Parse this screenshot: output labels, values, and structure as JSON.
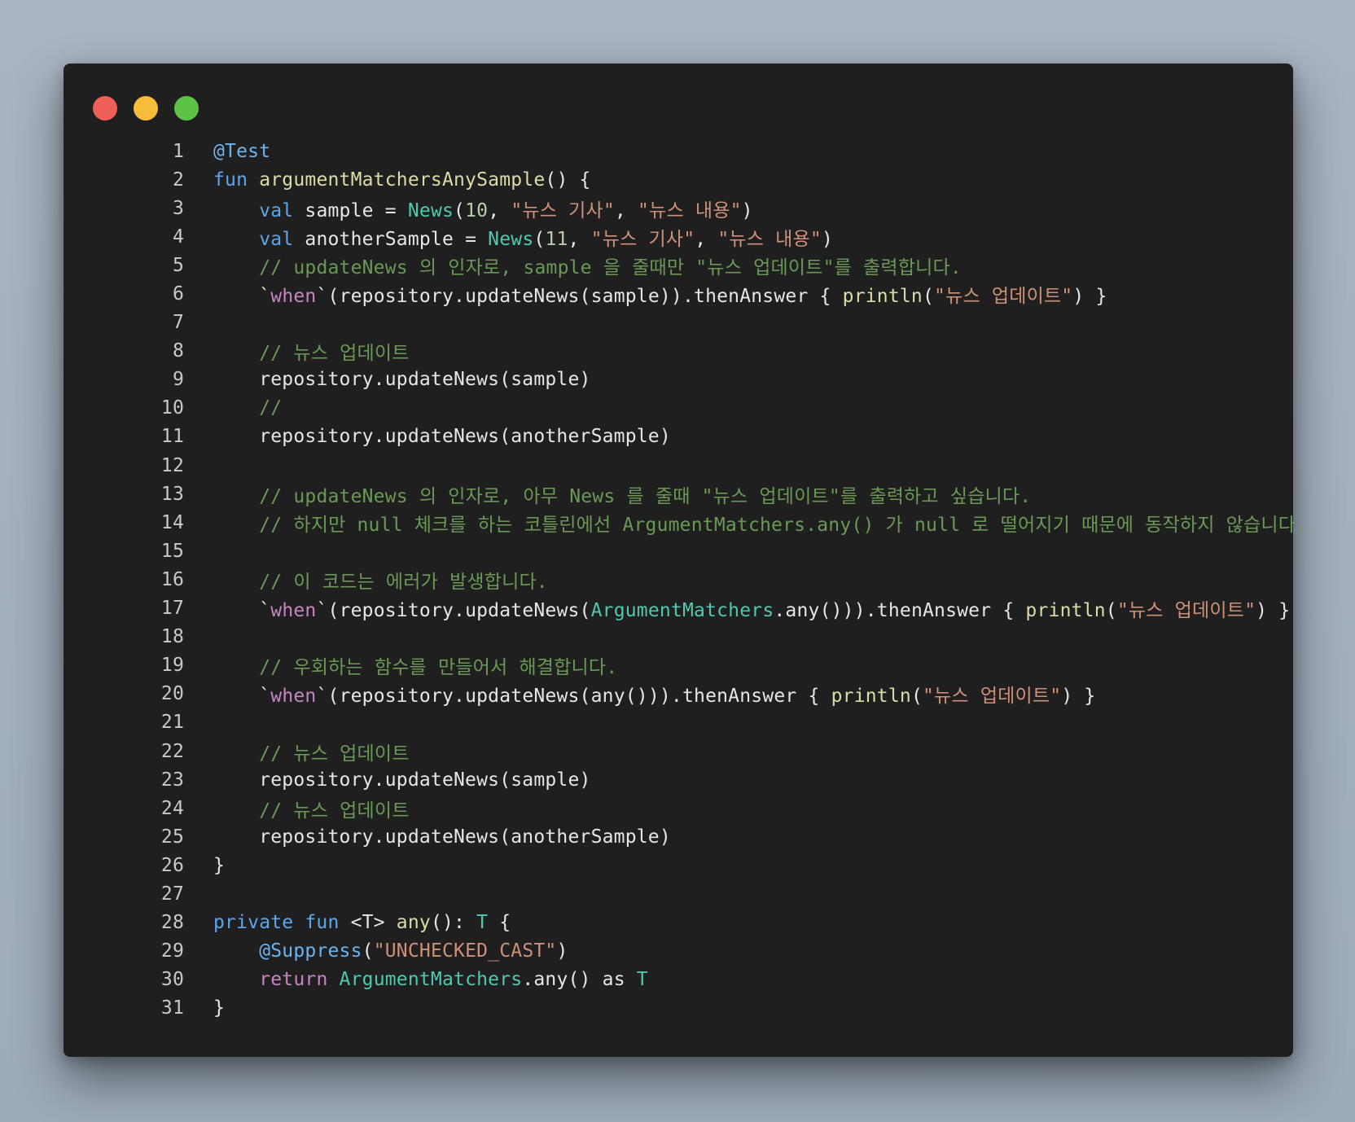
{
  "window": {
    "controls": {
      "close_color": "#ed5f57",
      "minimize_color": "#f5bd3a",
      "maximize_color": "#5cc345"
    }
  },
  "code": {
    "language": "kotlin",
    "lines": [
      [
        {
          "t": "@Test",
          "k": "anno"
        }
      ],
      [
        {
          "t": "fun ",
          "k": "kw"
        },
        {
          "t": "argumentMatchersAnySample",
          "k": "fn"
        },
        {
          "t": "() {",
          "k": "plain"
        }
      ],
      [
        {
          "t": "    ",
          "k": "plain"
        },
        {
          "t": "val ",
          "k": "kw"
        },
        {
          "t": "sample = ",
          "k": "plain"
        },
        {
          "t": "News",
          "k": "type"
        },
        {
          "t": "(",
          "k": "plain"
        },
        {
          "t": "10",
          "k": "num"
        },
        {
          "t": ", ",
          "k": "plain"
        },
        {
          "t": "\"뉴스 기사\"",
          "k": "str"
        },
        {
          "t": ", ",
          "k": "plain"
        },
        {
          "t": "\"뉴스 내용\"",
          "k": "str"
        },
        {
          "t": ")",
          "k": "plain"
        }
      ],
      [
        {
          "t": "    ",
          "k": "plain"
        },
        {
          "t": "val ",
          "k": "kw"
        },
        {
          "t": "anotherSample = ",
          "k": "plain"
        },
        {
          "t": "News",
          "k": "type"
        },
        {
          "t": "(",
          "k": "plain"
        },
        {
          "t": "11",
          "k": "num"
        },
        {
          "t": ", ",
          "k": "plain"
        },
        {
          "t": "\"뉴스 기사\"",
          "k": "str"
        },
        {
          "t": ", ",
          "k": "plain"
        },
        {
          "t": "\"뉴스 내용\"",
          "k": "str"
        },
        {
          "t": ")",
          "k": "plain"
        }
      ],
      [
        {
          "t": "    ",
          "k": "plain"
        },
        {
          "t": "// updateNews 의 인자로, sample 을 줄때만 \"뉴스 업데이트\"를 출력합니다.",
          "k": "com"
        }
      ],
      [
        {
          "t": "    ",
          "k": "plain"
        },
        {
          "t": "`",
          "k": "plain"
        },
        {
          "t": "when",
          "k": "ctl"
        },
        {
          "t": "`(repository.updateNews(sample)).thenAnswer { ",
          "k": "plain"
        },
        {
          "t": "println",
          "k": "fn"
        },
        {
          "t": "(",
          "k": "plain"
        },
        {
          "t": "\"뉴스 업데이트\"",
          "k": "str"
        },
        {
          "t": ") }",
          "k": "plain"
        }
      ],
      [],
      [
        {
          "t": "    ",
          "k": "plain"
        },
        {
          "t": "// 뉴스 업데이트",
          "k": "com"
        }
      ],
      [
        {
          "t": "    ",
          "k": "plain"
        },
        {
          "t": "repository.updateNews(sample)",
          "k": "plain"
        }
      ],
      [
        {
          "t": "    ",
          "k": "plain"
        },
        {
          "t": "//",
          "k": "com"
        }
      ],
      [
        {
          "t": "    ",
          "k": "plain"
        },
        {
          "t": "repository.updateNews(anotherSample)",
          "k": "plain"
        }
      ],
      [],
      [
        {
          "t": "    ",
          "k": "plain"
        },
        {
          "t": "// updateNews 의 인자로, 아무 News 를 줄때 \"뉴스 업데이트\"를 출력하고 싶습니다.",
          "k": "com"
        }
      ],
      [
        {
          "t": "    ",
          "k": "plain"
        },
        {
          "t": "// 하지만 null 체크를 하는 코틀린에선 ArgumentMatchers.any() 가 null 로 떨어지기 때문에 동작하지 않습니다.",
          "k": "com"
        }
      ],
      [],
      [
        {
          "t": "    ",
          "k": "plain"
        },
        {
          "t": "// 이 코드는 에러가 발생합니다.",
          "k": "com"
        }
      ],
      [
        {
          "t": "    ",
          "k": "plain"
        },
        {
          "t": "`",
          "k": "plain"
        },
        {
          "t": "when",
          "k": "ctl"
        },
        {
          "t": "`(repository.updateNews(",
          "k": "plain"
        },
        {
          "t": "ArgumentMatchers",
          "k": "type"
        },
        {
          "t": ".any())).thenAnswer { ",
          "k": "plain"
        },
        {
          "t": "println",
          "k": "fn"
        },
        {
          "t": "(",
          "k": "plain"
        },
        {
          "t": "\"뉴스 업데이트\"",
          "k": "str"
        },
        {
          "t": ") }",
          "k": "plain"
        }
      ],
      [],
      [
        {
          "t": "    ",
          "k": "plain"
        },
        {
          "t": "// 우회하는 함수를 만들어서 해결합니다.",
          "k": "com"
        }
      ],
      [
        {
          "t": "    ",
          "k": "plain"
        },
        {
          "t": "`",
          "k": "plain"
        },
        {
          "t": "when",
          "k": "ctl"
        },
        {
          "t": "`(repository.updateNews(any())).thenAnswer { ",
          "k": "plain"
        },
        {
          "t": "println",
          "k": "fn"
        },
        {
          "t": "(",
          "k": "plain"
        },
        {
          "t": "\"뉴스 업데이트\"",
          "k": "str"
        },
        {
          "t": ") }",
          "k": "plain"
        }
      ],
      [],
      [
        {
          "t": "    ",
          "k": "plain"
        },
        {
          "t": "// 뉴스 업데이트",
          "k": "com"
        }
      ],
      [
        {
          "t": "    ",
          "k": "plain"
        },
        {
          "t": "repository.updateNews(sample)",
          "k": "plain"
        }
      ],
      [
        {
          "t": "    ",
          "k": "plain"
        },
        {
          "t": "// 뉴스 업데이트",
          "k": "com"
        }
      ],
      [
        {
          "t": "    ",
          "k": "plain"
        },
        {
          "t": "repository.updateNews(anotherSample)",
          "k": "plain"
        }
      ],
      [
        {
          "t": "}",
          "k": "plain"
        }
      ],
      [],
      [
        {
          "t": "private fun ",
          "k": "kw"
        },
        {
          "t": "<T> ",
          "k": "plain"
        },
        {
          "t": "any",
          "k": "fn"
        },
        {
          "t": "(): ",
          "k": "plain"
        },
        {
          "t": "T",
          "k": "type"
        },
        {
          "t": " {",
          "k": "plain"
        }
      ],
      [
        {
          "t": "    ",
          "k": "plain"
        },
        {
          "t": "@Suppress",
          "k": "anno"
        },
        {
          "t": "(",
          "k": "plain"
        },
        {
          "t": "\"UNCHECKED_CAST\"",
          "k": "str"
        },
        {
          "t": ")",
          "k": "plain"
        }
      ],
      [
        {
          "t": "    ",
          "k": "plain"
        },
        {
          "t": "return ",
          "k": "ctl"
        },
        {
          "t": "ArgumentMatchers",
          "k": "type"
        },
        {
          "t": ".any() as ",
          "k": "plain"
        },
        {
          "t": "T",
          "k": "type"
        }
      ],
      [
        {
          "t": "}",
          "k": "plain"
        }
      ]
    ]
  }
}
